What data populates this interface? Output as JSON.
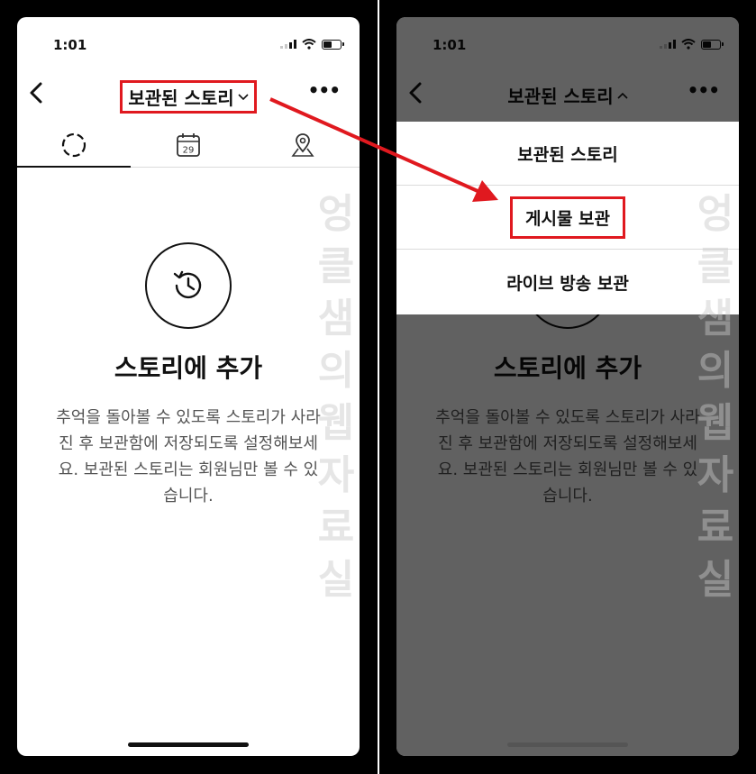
{
  "status": {
    "time": "1:01"
  },
  "header": {
    "title": "보관된 스토리"
  },
  "empty_state": {
    "title": "스토리에 추가",
    "description": "추억을 돌아볼 수 있도록 스토리가 사라진 후 보관함에 저장되도록 설정해보세요. 보관된 스토리는 회원님만 볼 수 있습니다."
  },
  "tabs": [
    {
      "icon": "story-ring-icon"
    },
    {
      "icon": "calendar-icon",
      "label": "29"
    },
    {
      "icon": "location-pin-icon"
    }
  ],
  "dropdown": {
    "items": [
      {
        "label": "보관된 스토리"
      },
      {
        "label": "게시물 보관"
      },
      {
        "label": "라이브 방송 보관"
      }
    ]
  },
  "watermark": "엉클샘의웹자료실",
  "colors": {
    "highlight": "#e0191f",
    "overlay": "rgba(0,0,0,0.62)"
  }
}
